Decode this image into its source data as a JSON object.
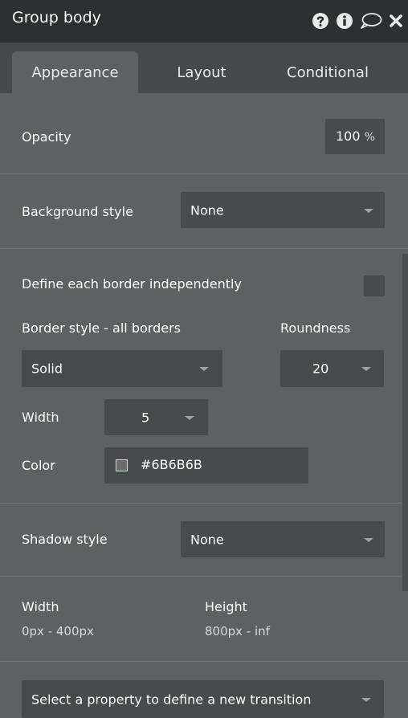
{
  "header": {
    "title": "Group body",
    "icons": [
      "help-icon",
      "info-icon",
      "comment-icon",
      "close-icon"
    ]
  },
  "tabs": [
    {
      "label": "Appearance",
      "active": true
    },
    {
      "label": "Layout",
      "active": false
    },
    {
      "label": "Conditional",
      "active": false
    }
  ],
  "opacity": {
    "label": "Opacity",
    "value": "100",
    "unit": "%"
  },
  "background": {
    "label": "Background style",
    "value": "None"
  },
  "border": {
    "independent_label": "Define each border independently",
    "independent_checked": false,
    "style_label": "Border style - all borders",
    "style_value": "Solid",
    "roundness_label": "Roundness",
    "roundness_value": "20",
    "width_label": "Width",
    "width_value": "5",
    "color_label": "Color",
    "color_value": "#6B6B6B"
  },
  "shadow": {
    "label": "Shadow style",
    "value": "None"
  },
  "size": {
    "width_label": "Width",
    "width_value": "0px - 400px",
    "height_label": "Height",
    "height_value": "800px - inf"
  },
  "transition": {
    "placeholder": "Select a property to define a new transition"
  },
  "colors": {
    "panel_bg": "#5d6161",
    "header_bg": "#2d3031",
    "tabbar_bg": "#454949",
    "field_bg": "#474b4b",
    "swatch": "#6b6b6b"
  }
}
